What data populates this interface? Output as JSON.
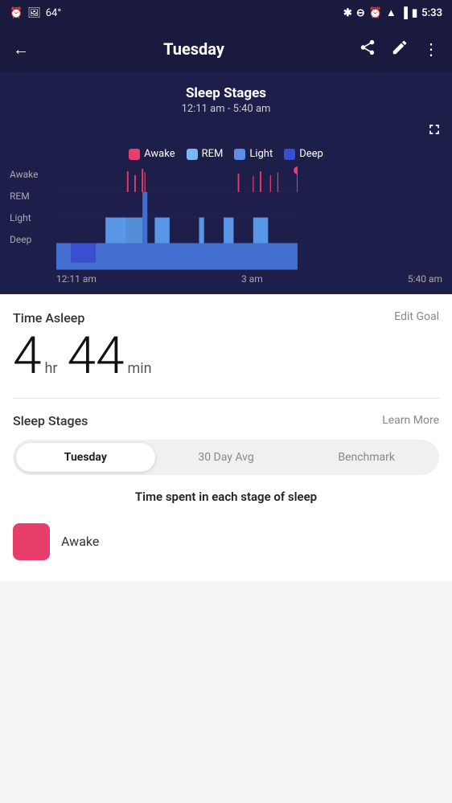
{
  "statusBar": {
    "time": "5:33",
    "temp": "64°",
    "icons": [
      "alarm",
      "image",
      "bluetooth",
      "minus-circle",
      "alarm",
      "wifi",
      "signal",
      "battery"
    ]
  },
  "header": {
    "back_label": "←",
    "title": "Tuesday",
    "share_icon": "share",
    "edit_icon": "edit",
    "more_icon": "more"
  },
  "chart": {
    "title": "Sleep Stages",
    "time_range": "12:11 am - 5:40 am",
    "expand_icon": "expand",
    "legend": [
      {
        "label": "Awake",
        "color": "#e83e6c"
      },
      {
        "label": "REM",
        "color": "#7ab8f5"
      },
      {
        "label": "Light",
        "color": "#5b8fe8"
      },
      {
        "label": "Deep",
        "color": "#3a4fcf"
      }
    ],
    "y_labels": [
      "Awake",
      "REM",
      "Light",
      "Deep"
    ],
    "x_labels": [
      "12:11 am",
      "3 am",
      "5:40 am"
    ]
  },
  "timeAsleep": {
    "label": "Time Asleep",
    "edit_goal": "Edit Goal",
    "hours": "4",
    "hr_unit": "hr",
    "minutes": "44",
    "min_unit": "min"
  },
  "sleepStages": {
    "label": "Sleep Stages",
    "learn_more": "Learn More",
    "tabs": [
      {
        "label": "Tuesday",
        "active": true
      },
      {
        "label": "30 Day Avg",
        "active": false
      },
      {
        "label": "Benchmark",
        "active": false
      }
    ],
    "subtitle": "Time spent in each stage of sleep",
    "stages": [
      {
        "label": "Awake",
        "color": "#e83e6c"
      }
    ]
  }
}
